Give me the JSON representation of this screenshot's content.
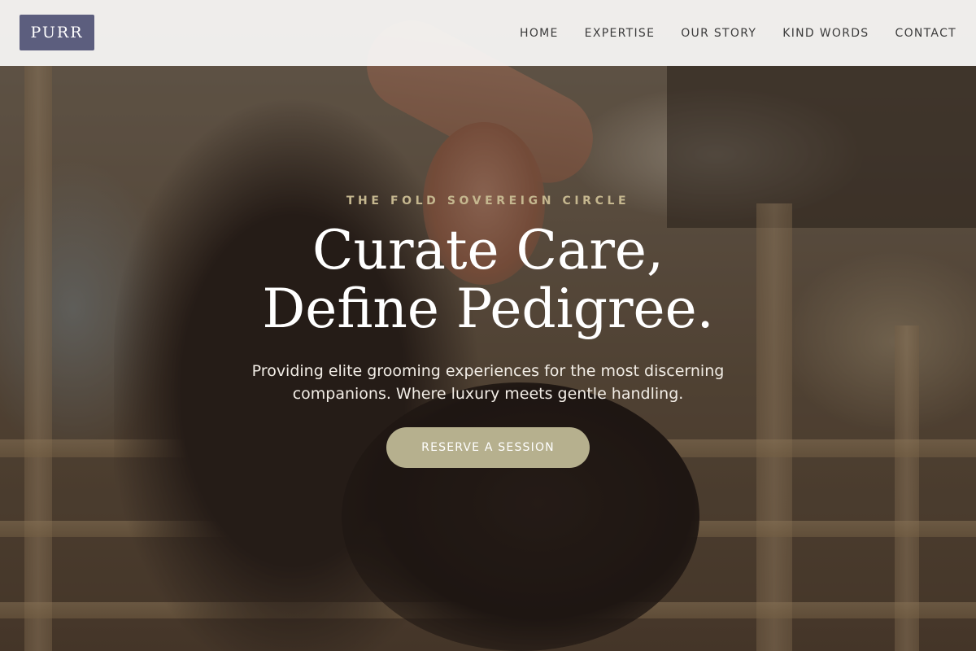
{
  "header": {
    "logo_text": "PURR",
    "nav": [
      {
        "label": "HOME"
      },
      {
        "label": "EXPERTISE"
      },
      {
        "label": "OUR STORY"
      },
      {
        "label": "KIND WORDS"
      },
      {
        "label": "CONTACT"
      }
    ]
  },
  "hero": {
    "eyebrow": "THE FOLD SOVEREIGN CIRCLE",
    "headline_line1": "Curate Care,",
    "headline_line2": "Define Pedigree.",
    "subtext": "Providing elite grooming experiences for the most discerning companions. Where luxury meets gentle handling.",
    "cta_label": "RESERVE A SESSION"
  },
  "colors": {
    "logo_bg": "#5c5e7e",
    "accent_gold": "#c5b78f",
    "cta_bg": "#b6b08e"
  }
}
